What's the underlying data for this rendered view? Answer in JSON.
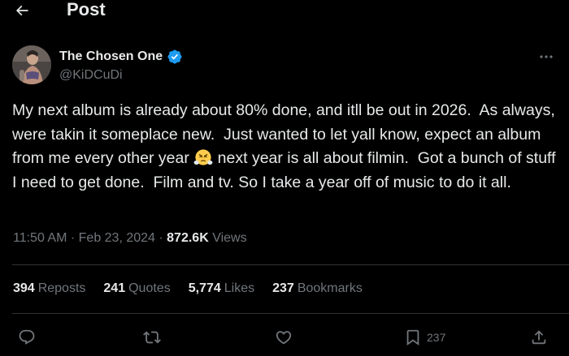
{
  "header": {
    "title": "Post"
  },
  "author": {
    "display_name": "The Chosen One",
    "handle": "@KiDCuDi",
    "verified_badge": "verified-badge-icon",
    "badge_color": "#1d9bf0"
  },
  "tweet": {
    "text_before_emoji": "My next album is already about 80% done, and itll be out in 2026.  As always, were takin it someplace new.  Just wanted to let yall know, expect an album from me every other year ",
    "emoji": "face-with-steam-from-nose",
    "text_after_emoji": " next year is all about filmin.  Got a bunch of stuff I need to get done.  Film and tv. So I take a year off of music to do it all."
  },
  "meta": {
    "time": "11:50 AM",
    "sep1": " · ",
    "date": "Feb 23, 2024",
    "sep2": " · ",
    "views_count": "872.6K",
    "views_label": " Views"
  },
  "stats": {
    "reposts": {
      "count": "394",
      "label": "Reposts"
    },
    "quotes": {
      "count": "241",
      "label": "Quotes"
    },
    "likes": {
      "count": "5,774",
      "label": "Likes"
    },
    "bookmarks": {
      "count": "237",
      "label": "Bookmarks"
    }
  },
  "actions": {
    "reply_icon": "reply-icon",
    "repost_icon": "repost-icon",
    "like_icon": "heart-icon",
    "bookmark_icon": "bookmark-icon",
    "bookmark_count": "237",
    "share_icon": "share-icon"
  },
  "colors": {
    "background": "#000000",
    "text": "#e7e9ea",
    "secondary": "#71767b",
    "divider": "#2f3336",
    "accent": "#1d9bf0"
  }
}
